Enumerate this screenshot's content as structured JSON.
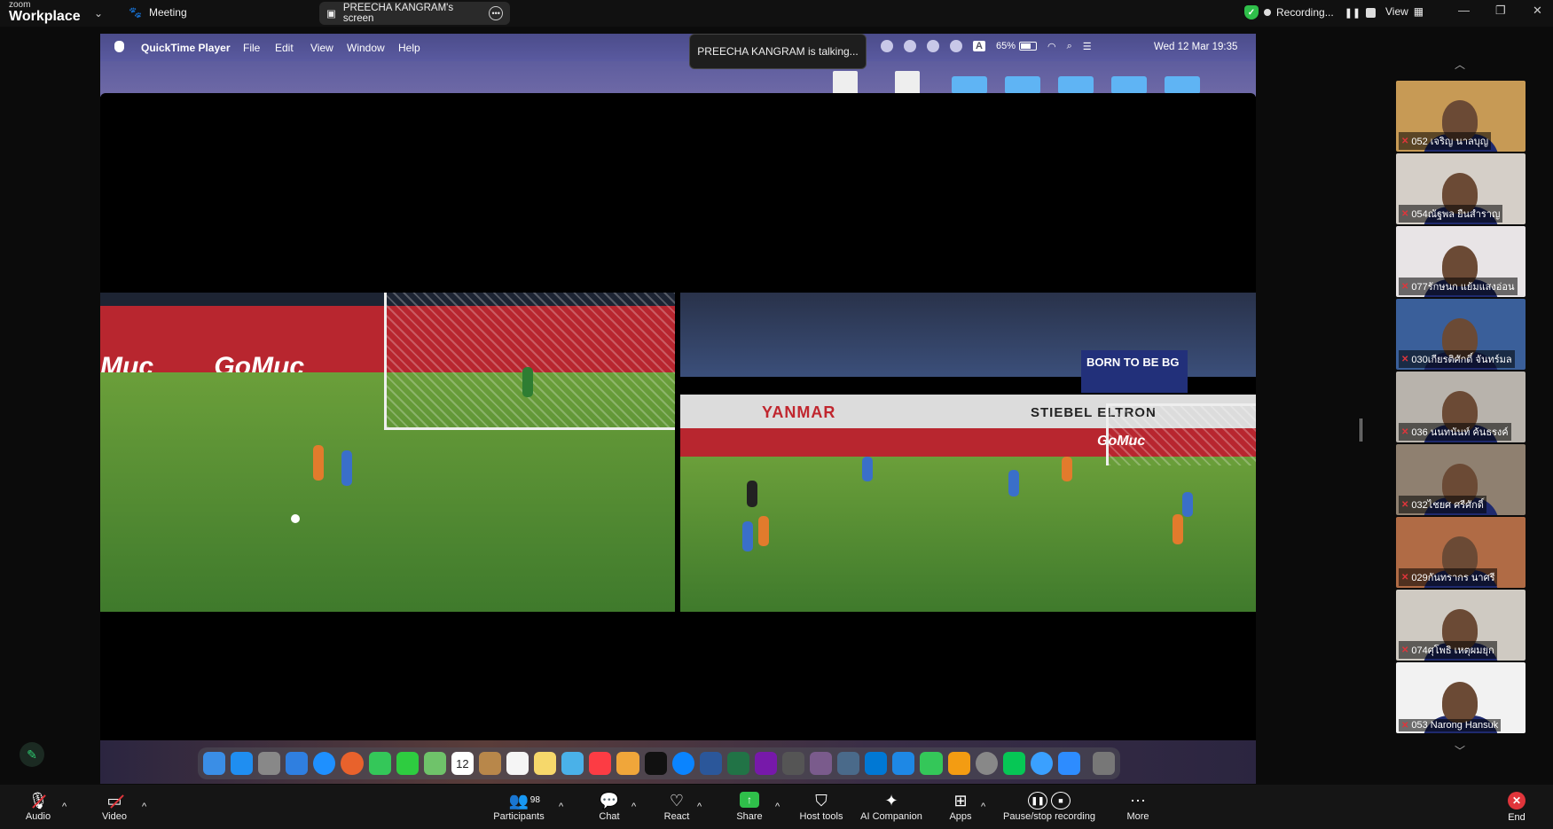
{
  "topbar": {
    "logo_small": "zoom",
    "logo_big": "Workplace",
    "meeting_label": "Meeting",
    "share_label": "PREECHA KANGRAM's screen",
    "recording_label": "Recording...",
    "view_label": "View"
  },
  "shared": {
    "app_name": "QuickTime Player",
    "menus": [
      "File",
      "Edit",
      "View",
      "Window",
      "Help"
    ],
    "talking": "PREECHA KANGRAM is talking...",
    "battery": "65%",
    "clock": "Wed 12 Mar  19:35",
    "board_text_left": "GoMuc",
    "board_text_right": "GoMuc",
    "yanmar": "YANMAR",
    "stiebel": "STIEBEL ELTRON",
    "born": "BORN TO BE BG",
    "calendar_day": "12"
  },
  "gallery": [
    {
      "name": "052 เจริญ นาลบุญ",
      "bg": "#c79a55"
    },
    {
      "name": "054ณัฐพล ยืนสำราญ",
      "bg": "#d5cfc8"
    },
    {
      "name": "077รักษนก แย้มแสงอ่อน",
      "bg": "#e8e4e6"
    },
    {
      "name": "030เกียรติศักดิ์ จันทร์มล",
      "bg": "#3a5f9a"
    },
    {
      "name": "036 นนทนันท์ ค้นธรงค์",
      "bg": "#b8b3ac"
    },
    {
      "name": "032ไชยศ  ศรีศักดิ์",
      "bg": "#8f8070"
    },
    {
      "name": "029กันทรากร นาศรี",
      "bg": "#b06b45"
    },
    {
      "name": "074ศุโพธิ เหตุผมยุก",
      "bg": "#cfcac2"
    },
    {
      "name": "053 Narong Hansuk",
      "bg": "#f2f2f2"
    }
  ],
  "toolbar": {
    "audio": "Audio",
    "video": "Video",
    "participants": "Participants",
    "participants_count": "98",
    "chat": "Chat",
    "react": "React",
    "share": "Share",
    "host_tools": "Host tools",
    "ai": "AI Companion",
    "apps": "Apps",
    "pause_rec": "Pause/stop recording",
    "more": "More",
    "end": "End"
  }
}
